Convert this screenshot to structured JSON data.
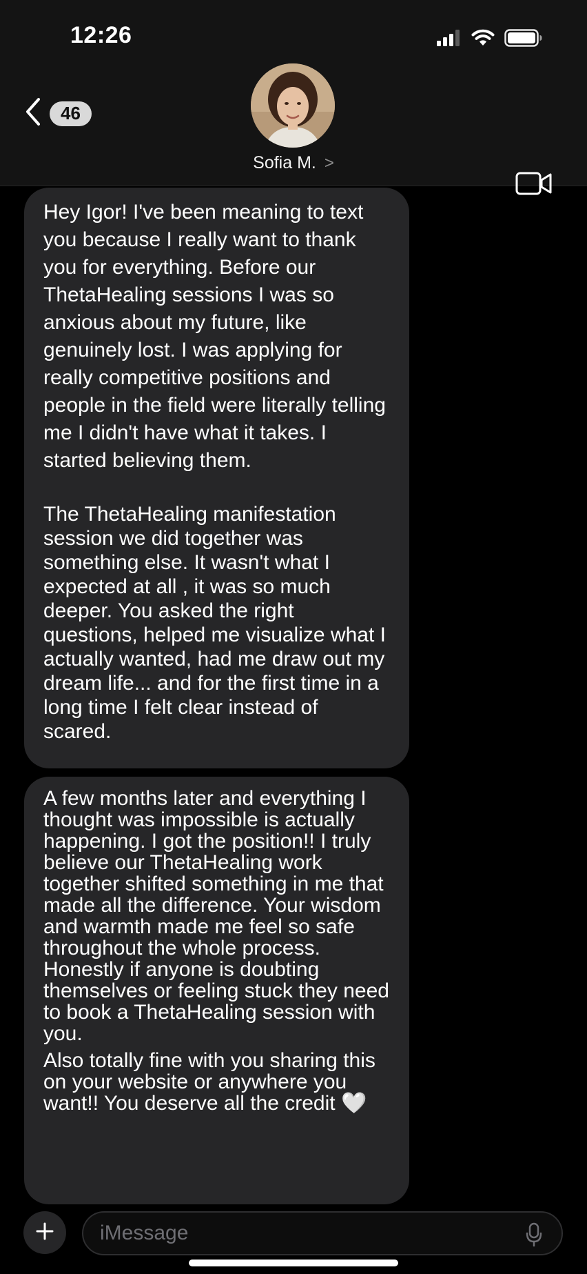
{
  "status_bar": {
    "time": "12:26"
  },
  "nav": {
    "unread_count": "46",
    "contact_name": "Sofia M.",
    "contact_chevron": ">"
  },
  "messages": [
    {
      "paragraphs": [
        "Hey Igor! I've been meaning to text you because I really want to thank you for everything. Before our ThetaHealing sessions I was so anxious about my future, like genuinely lost. I was applying for really competitive positions and people in the field were literally telling me I didn't have what it takes. I started believing them.",
        "The ThetaHealing manifestation session we did together was something else. It wasn't what I expected at all , it was so much deeper. You asked the right questions, helped me visualize what I actually wanted, had me draw out my dream life... and for the first time in a long time I felt clear instead of scared."
      ]
    },
    {
      "paragraphs": [
        "A few months later and everything I thought was impossible is actually happening. I got the position!! I truly believe our ThetaHealing work together shifted something in me that made all the difference. Your wisdom and warmth made me feel so safe throughout the whole process. Honestly if anyone is doubting themselves or feeling stuck they need to book a ThetaHealing session with you.",
        "Also totally fine with you sharing this on your website or anywhere you want!! You deserve all the credit"
      ],
      "emoji": "🤍"
    }
  ],
  "composer": {
    "placeholder": "iMessage"
  },
  "icons": {
    "back": "chevron-left-icon",
    "video": "video-camera-icon",
    "plus": "plus-icon",
    "mic": "microphone-icon",
    "signal": "cellular-signal-icon",
    "wifi": "wifi-icon",
    "battery": "battery-icon"
  },
  "colors": {
    "background": "#000000",
    "header": "#141414",
    "bubble": "#262628",
    "placeholder": "#6e6e73"
  }
}
